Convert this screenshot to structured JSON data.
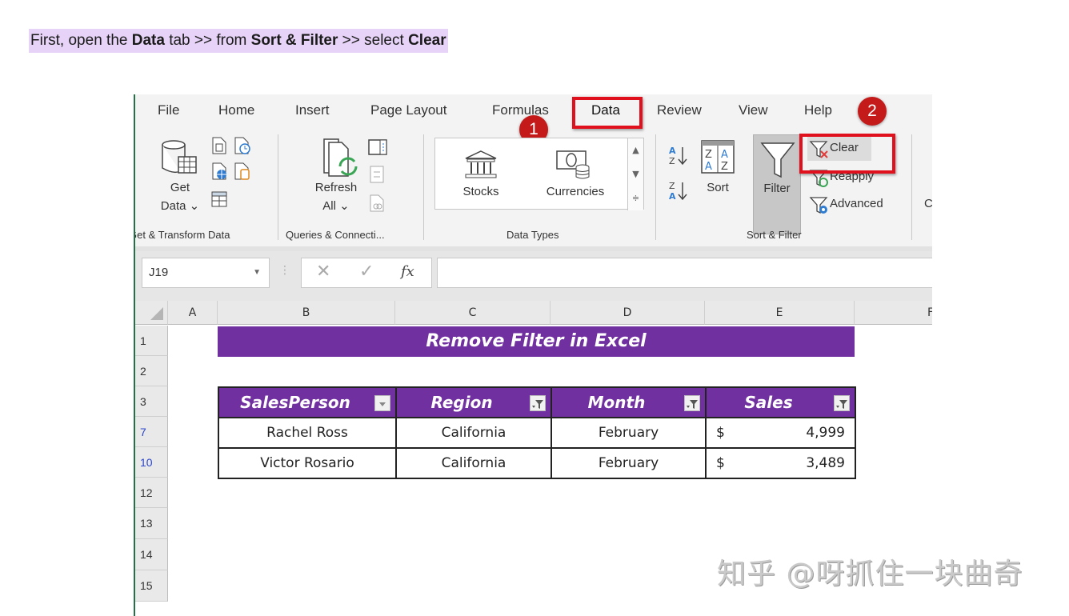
{
  "instruction": {
    "part1": "First, open the ",
    "bold1": "Data",
    "part2": " tab >> from ",
    "bold2": "Sort & Filter",
    "part3": " >> select ",
    "bold3": "Clear"
  },
  "ribbon_tabs": [
    "File",
    "Home",
    "Insert",
    "Page Layout",
    "Formulas",
    "Data",
    "Review",
    "View",
    "Help"
  ],
  "active_tab": "Data",
  "badges": {
    "step1": "1",
    "step2": "2"
  },
  "groups": {
    "get_transform": {
      "label": "Get & Transform Data",
      "get_data_line1": "Get",
      "get_data_line2": "Data ⌄"
    },
    "queries": {
      "label": "Queries & Connecti...",
      "refresh_line1": "Refresh",
      "refresh_line2": "All ⌄"
    },
    "data_types": {
      "label": "Data Types",
      "stocks": "Stocks",
      "currencies": "Currencies"
    },
    "sort_filter": {
      "label": "Sort & Filter",
      "sort": "Sort",
      "filter": "Filter",
      "clear": "Clear",
      "reapply": "Reapply",
      "advanced": "Advanced",
      "cut_next": "C"
    }
  },
  "formula_bar": {
    "name_box": "J19",
    "fx": "fx",
    "formula": ""
  },
  "columns": [
    "A",
    "B",
    "C",
    "D",
    "E",
    "F"
  ],
  "rows": [
    "1",
    "2",
    "3",
    "7",
    "10",
    "12",
    "13",
    "14",
    "15"
  ],
  "sheet": {
    "title": "Remove Filter in Excel",
    "headers": [
      "SalesPerson",
      "Region",
      "Month",
      "Sales"
    ],
    "data": [
      {
        "salesperson": "Rachel Ross",
        "region": "California",
        "month": "February",
        "currency": "$",
        "sales": "4,999"
      },
      {
        "salesperson": "Victor Rosario",
        "region": "California",
        "month": "February",
        "currency": "$",
        "sales": "3,489"
      }
    ]
  },
  "watermark": "知乎 @呀抓住一块曲奇",
  "colors": {
    "header_purple": "#7030a0",
    "highlight_red": "#e0101d",
    "badge_red": "#c41a1a",
    "excel_green": "#217346"
  }
}
